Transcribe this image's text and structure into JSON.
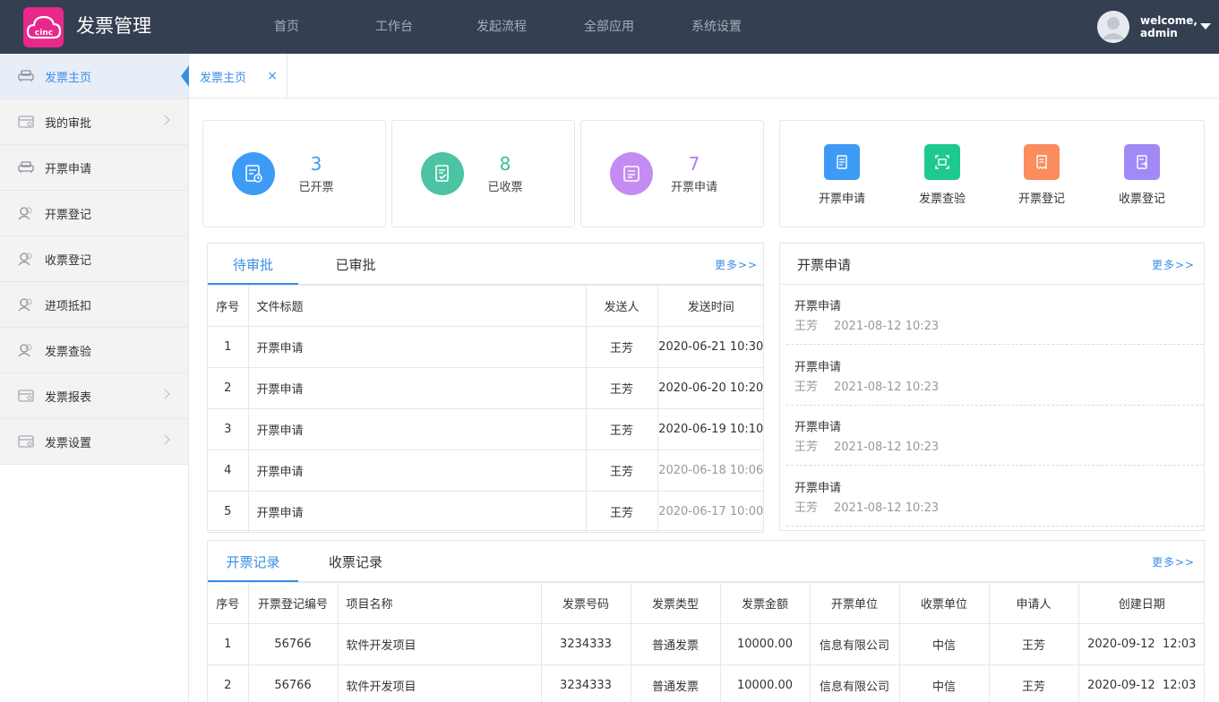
{
  "app": {
    "title": "发票管理",
    "logo_text": "cinc"
  },
  "topnav": [
    "首页",
    "工作台",
    "发起流程",
    "全部应用",
    "系统设置"
  ],
  "user": {
    "line1": "welcome,",
    "line2": "admin"
  },
  "sidebar": {
    "items": [
      {
        "label": "发票主页",
        "icon": "sofa-icon",
        "arrow": false,
        "active": true
      },
      {
        "label": "我的审批",
        "icon": "card-icon",
        "arrow": true
      },
      {
        "label": "开票申请",
        "icon": "sofa-icon",
        "arrow": false
      },
      {
        "label": "开票登记",
        "icon": "users-icon",
        "arrow": false
      },
      {
        "label": "收票登记",
        "icon": "users-icon",
        "arrow": false
      },
      {
        "label": "进项抵扣",
        "icon": "users-icon",
        "arrow": false
      },
      {
        "label": "发票查验",
        "icon": "users-icon",
        "arrow": false
      },
      {
        "label": "发票报表",
        "icon": "card-icon",
        "arrow": true
      },
      {
        "label": "发票设置",
        "icon": "card-icon",
        "arrow": true
      }
    ]
  },
  "page_tab": {
    "label": "发票主页",
    "close": "×"
  },
  "stats": [
    {
      "num": "3",
      "label": "已开票",
      "color": "#3e9bf5",
      "num_color": "#3e9bf5"
    },
    {
      "num": "8",
      "label": "已收票",
      "color": "#4cc3a3",
      "num_color": "#3bbf97"
    },
    {
      "num": "7",
      "label": "开票申请",
      "color": "#c48cf2",
      "num_color": "#b07be8"
    }
  ],
  "quick_actions": [
    {
      "label": "开票申请",
      "color": "#3e9bf5"
    },
    {
      "label": "发票查验",
      "color": "#1ec98f"
    },
    {
      "label": "开票登记",
      "color": "#fb8c5d"
    },
    {
      "label": "收票登记",
      "color": "#a18af5"
    }
  ],
  "approval": {
    "tabs": [
      "待审批",
      "已审批"
    ],
    "more": "更多>>",
    "headers": [
      "序号",
      "文件标题",
      "发送人",
      "发送时间"
    ],
    "rows": [
      {
        "no": "1",
        "title": "开票申请",
        "sender": "王芳",
        "time": "2020-06-21 10:30",
        "muted": false
      },
      {
        "no": "2",
        "title": "开票申请",
        "sender": "王芳",
        "time": "2020-06-20 10:20",
        "muted": false
      },
      {
        "no": "3",
        "title": "开票申请",
        "sender": "王芳",
        "time": "2020-06-19 10:10",
        "muted": false
      },
      {
        "no": "4",
        "title": "开票申请",
        "sender": "王芳",
        "time": "2020-06-18 10:06",
        "muted": true
      },
      {
        "no": "5",
        "title": "开票申请",
        "sender": "王芳",
        "time": "2020-06-17 10:00",
        "muted": true
      }
    ]
  },
  "apply_panel": {
    "title": "开票申请",
    "more": "更多>>",
    "items": [
      {
        "title": "开票申请",
        "name": "王芳",
        "time": "2021-08-12 10:23"
      },
      {
        "title": "开票申请",
        "name": "王芳",
        "time": "2021-08-12 10:23"
      },
      {
        "title": "开票申请",
        "name": "王芳",
        "time": "2021-08-12 10:23"
      },
      {
        "title": "开票申请",
        "name": "王芳",
        "time": "2021-08-12 10:23"
      }
    ]
  },
  "records": {
    "tabs": [
      "开票记录",
      "收票记录"
    ],
    "more": "更多>>",
    "headers": [
      "序号",
      "开票登记编号",
      "项目名称",
      "发票号码",
      "发票类型",
      "发票金额",
      "开票单位",
      "收票单位",
      "申请人",
      "创建日期"
    ],
    "rows": [
      [
        "1",
        "56766",
        "软件开发项目",
        "3234333",
        "普通发票",
        "10000.00",
        "信息有限公司",
        "中信",
        "王芳",
        "2020-09-12  12:03"
      ],
      [
        "2",
        "56766",
        "软件开发项目",
        "3234333",
        "普通发票",
        "10000.00",
        "信息有限公司",
        "中信",
        "王芳",
        "2020-09-12  12:03"
      ]
    ]
  }
}
